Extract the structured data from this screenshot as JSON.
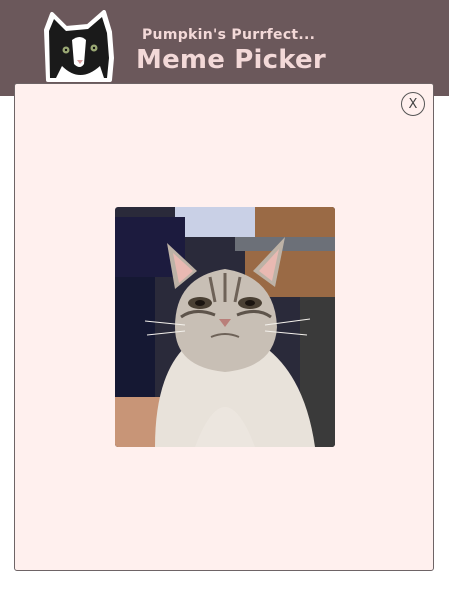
{
  "header": {
    "tagline": "Pumpkin's Purrfect...",
    "title": "Meme Picker",
    "logo_icon": "cat-logo-icon",
    "background_color": "#6b585b",
    "text_color": "#f3d9d8"
  },
  "modal": {
    "close_label": "X",
    "background_color": "#fff0ee",
    "image_icon": "grumpy-cat-meme-image"
  }
}
